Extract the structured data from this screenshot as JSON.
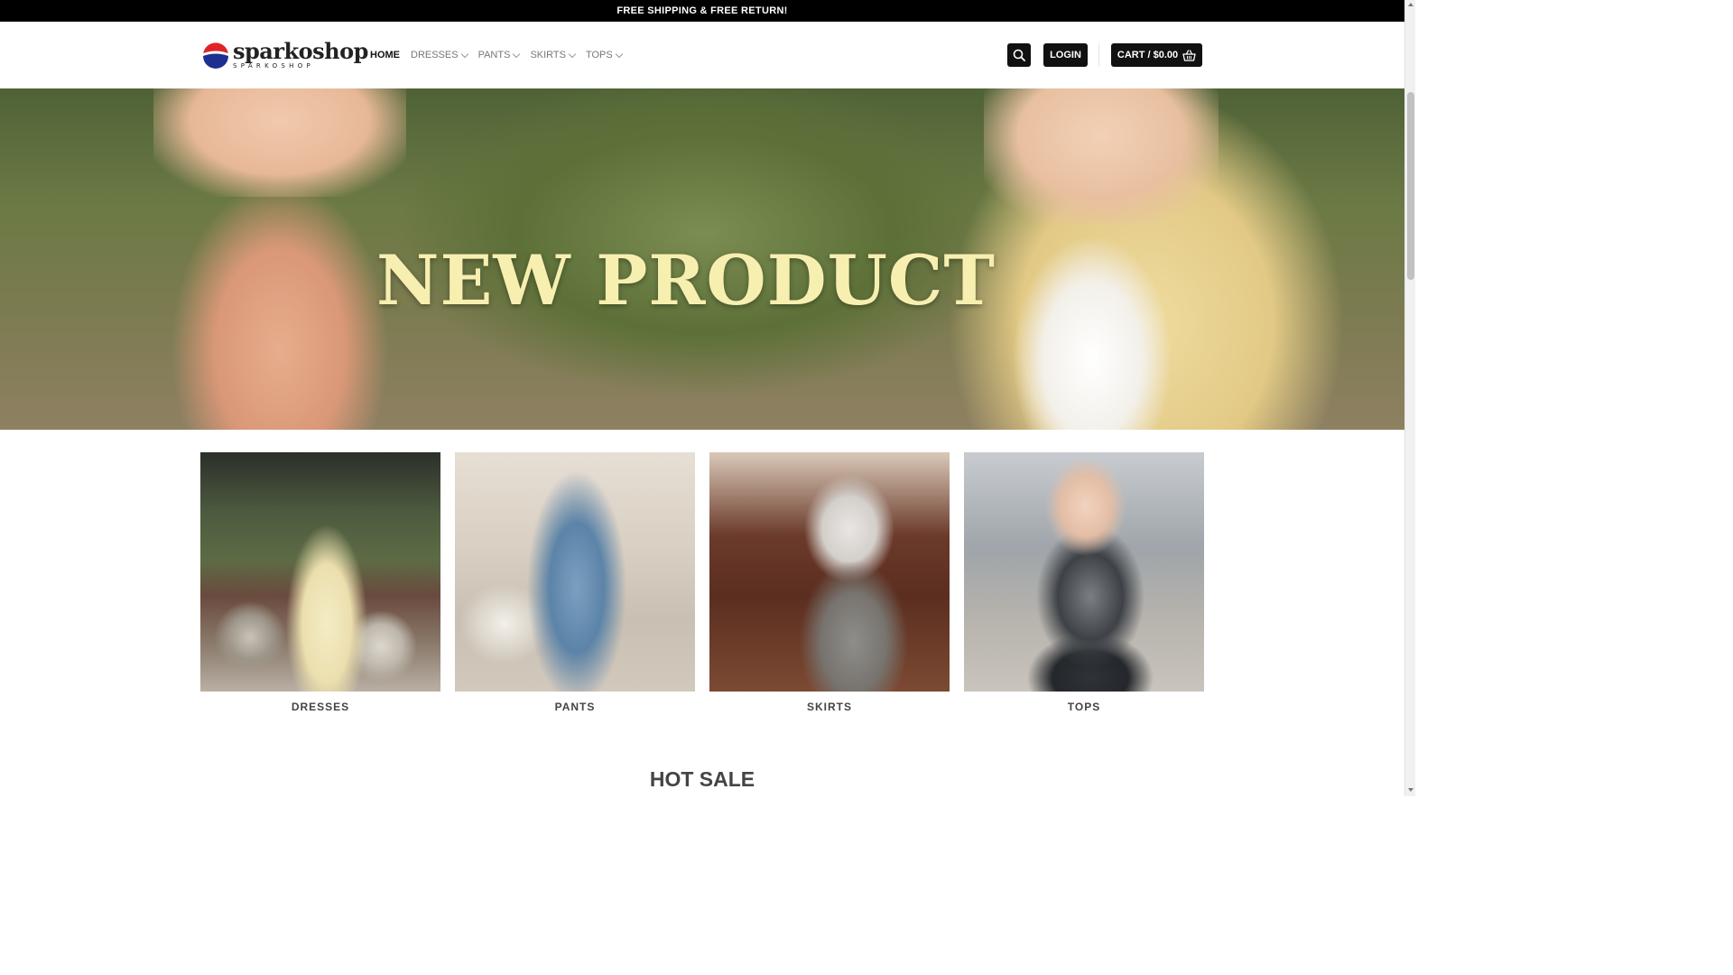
{
  "topbar": {
    "text": "FREE SHIPPING & FREE RETURN!"
  },
  "header": {
    "logo_name": "sparkoshop",
    "logo_sub": "SPARKOSHOP",
    "nav": [
      {
        "label": "HOME",
        "active": true,
        "dropdown": false
      },
      {
        "label": "DRESSES",
        "active": false,
        "dropdown": true
      },
      {
        "label": "PANTS",
        "active": false,
        "dropdown": true
      },
      {
        "label": "SKIRTS",
        "active": false,
        "dropdown": true
      },
      {
        "label": "TOPS",
        "active": false,
        "dropdown": true
      }
    ],
    "search_icon": "search-icon",
    "login_label": "LOGIN",
    "cart_label": "CART / $0.00",
    "cart_icon": "basket-icon"
  },
  "hero": {
    "title": "NEW PRODUCT"
  },
  "categories": [
    {
      "label": "DRESSES"
    },
    {
      "label": "PANTS"
    },
    {
      "label": "SKIRTS"
    },
    {
      "label": "TOPS"
    }
  ],
  "sections": {
    "hot_sale_title": "HOT SALE"
  },
  "colors": {
    "topbar_bg": "#000000",
    "button_bg": "#111111",
    "hero_text": "#f7efb0"
  }
}
